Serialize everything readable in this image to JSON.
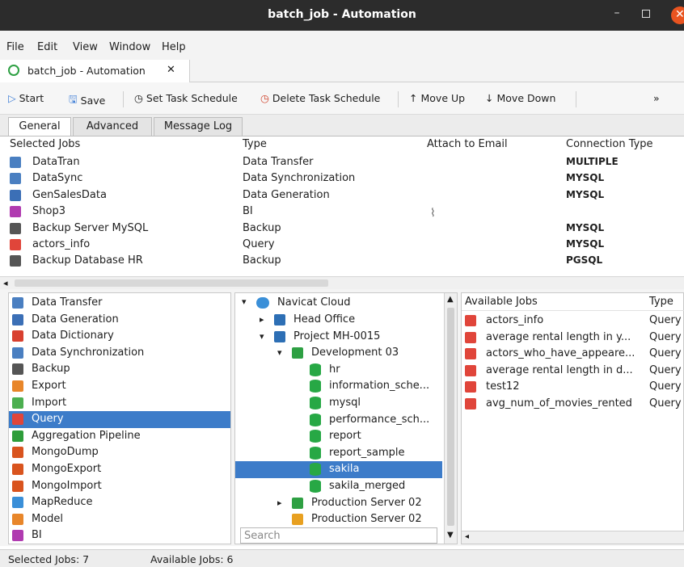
{
  "window": {
    "title": "batch_job - Automation"
  },
  "menu": [
    "File",
    "Edit",
    "View",
    "Window",
    "Help"
  ],
  "doc_tab": {
    "label": "batch_job - Automation"
  },
  "toolbar": {
    "start": "Start",
    "save": "Save",
    "set_schedule": "Set Task Schedule",
    "delete_schedule": "Delete Task Schedule",
    "move_up": "Move Up",
    "move_down": "Move Down",
    "more": "»"
  },
  "tabs": [
    "General",
    "Advanced",
    "Message Log"
  ],
  "jobs_table": {
    "columns": [
      "Selected Jobs",
      "Type",
      "Attach to Email",
      "Connection Type"
    ],
    "rows": [
      {
        "name": "DataTran",
        "type": "Data Transfer",
        "conn": "MULTIPLE",
        "icon": "data-transfer-icon",
        "color": "#4a7fc1"
      },
      {
        "name": "DataSync",
        "type": "Data Synchronization",
        "conn": "MYSQL",
        "icon": "data-sync-icon",
        "color": "#4a7fc1"
      },
      {
        "name": "GenSalesData",
        "type": "Data Generation",
        "conn": "MYSQL",
        "icon": "data-generation-icon",
        "color": "#3b6fb6"
      },
      {
        "name": "Shop3",
        "type": "BI",
        "conn": "",
        "icon": "bi-icon",
        "color": "#b03bb0"
      },
      {
        "name": "Backup Server MySQL",
        "type": "Backup",
        "conn": "MYSQL",
        "icon": "backup-icon",
        "color": "#555555"
      },
      {
        "name": "actors_info",
        "type": "Query",
        "conn": "MYSQL",
        "icon": "query-icon",
        "color": "#e0453a"
      },
      {
        "name": "Backup Database HR",
        "type": "Backup",
        "conn": "PGSQL",
        "icon": "backup-icon",
        "color": "#555555"
      }
    ]
  },
  "job_types": [
    {
      "label": "Data Transfer",
      "icon": "data-transfer-icon",
      "color": "#4a7fc1"
    },
    {
      "label": "Data Generation",
      "icon": "data-generation-icon",
      "color": "#3b6fb6"
    },
    {
      "label": "Data Dictionary",
      "icon": "data-dictionary-icon",
      "color": "#d8402f"
    },
    {
      "label": "Data Synchronization",
      "icon": "data-sync-icon",
      "color": "#4a7fc1"
    },
    {
      "label": "Backup",
      "icon": "backup-icon",
      "color": "#555555"
    },
    {
      "label": "Export",
      "icon": "export-icon",
      "color": "#e8862a"
    },
    {
      "label": "Import",
      "icon": "import-icon",
      "color": "#4caf50"
    },
    {
      "label": "Query",
      "icon": "query-icon",
      "color": "#e0453a"
    },
    {
      "label": "Aggregation Pipeline",
      "icon": "aggregation-pipeline-icon",
      "color": "#2e9d3a"
    },
    {
      "label": "MongoDump",
      "icon": "mongodump-icon",
      "color": "#d9541e"
    },
    {
      "label": "MongoExport",
      "icon": "mongoexport-icon",
      "color": "#d9541e"
    },
    {
      "label": "MongoImport",
      "icon": "mongoimport-icon",
      "color": "#d9541e"
    },
    {
      "label": "MapReduce",
      "icon": "mapreduce-icon",
      "color": "#3a8fd8"
    },
    {
      "label": "Model",
      "icon": "model-icon",
      "color": "#e8862a"
    },
    {
      "label": "BI",
      "icon": "bi-icon",
      "color": "#b03bb0"
    }
  ],
  "selected_job_type": "Query",
  "tree": {
    "root": "Navicat Cloud",
    "nodes": [
      {
        "label": "Head Office",
        "depth": 1,
        "arrow": "▸",
        "icon": "server-icon"
      },
      {
        "label": "Project MH-0015",
        "depth": 1,
        "arrow": "▾",
        "icon": "project-icon"
      },
      {
        "label": "Development 03",
        "depth": 2,
        "arrow": "▾",
        "icon": "connection-icon"
      },
      {
        "label": "hr",
        "depth": 3,
        "arrow": "",
        "icon": "database-icon"
      },
      {
        "label": "information_sche...",
        "depth": 3,
        "arrow": "",
        "icon": "database-icon"
      },
      {
        "label": "mysql",
        "depth": 3,
        "arrow": "",
        "icon": "database-icon"
      },
      {
        "label": "performance_sch...",
        "depth": 3,
        "arrow": "",
        "icon": "database-icon"
      },
      {
        "label": "report",
        "depth": 3,
        "arrow": "",
        "icon": "database-icon"
      },
      {
        "label": "report_sample",
        "depth": 3,
        "arrow": "",
        "icon": "database-icon"
      },
      {
        "label": "sakila",
        "depth": 3,
        "arrow": "",
        "icon": "database-icon"
      },
      {
        "label": "sakila_merged",
        "depth": 3,
        "arrow": "",
        "icon": "database-icon"
      },
      {
        "label": "Production Server 02",
        "depth": 2,
        "arrow": "▸",
        "icon": "connection-icon"
      },
      {
        "label": "Production Server 02",
        "depth": 2,
        "arrow": "",
        "icon": "connection-icon"
      }
    ],
    "selected": "sakila",
    "search_placeholder": "Search"
  },
  "available": {
    "columns": [
      "Available Jobs",
      "Type"
    ],
    "rows": [
      {
        "name": "actors_info",
        "type": "Query"
      },
      {
        "name": "average rental length in y...",
        "type": "Query"
      },
      {
        "name": "actors_who_have_appeare...",
        "type": "Query"
      },
      {
        "name": "average rental length in d...",
        "type": "Query"
      },
      {
        "name": "test12",
        "type": "Query"
      },
      {
        "name": "avg_num_of_movies_rented",
        "type": "Query"
      }
    ]
  },
  "status": {
    "selected": "Selected Jobs: 7",
    "available": "Available Jobs: 6"
  }
}
